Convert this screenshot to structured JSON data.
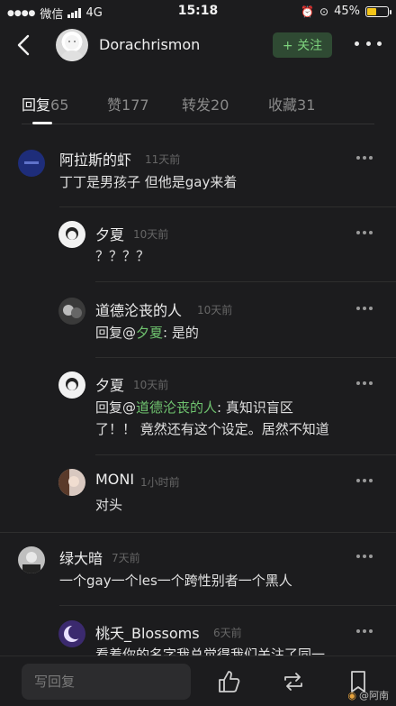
{
  "status_bar": {
    "carrier": "微信",
    "network": "4G",
    "time": "15:18",
    "battery": "45%",
    "battery_level": 0.45
  },
  "header": {
    "username": "Dorachrismon",
    "follow_label": "+ 关注"
  },
  "tabs": [
    {
      "label": "回复",
      "count": "65"
    },
    {
      "label": "赞",
      "count": "177"
    },
    {
      "label": "转发",
      "count": "20"
    },
    {
      "label": "收藏",
      "count": "31"
    }
  ],
  "comments": [
    {
      "name": "阿拉斯的虾",
      "time": "11天前",
      "text": "丁丁是男孩子 但他是gay来着"
    },
    {
      "name": "夕夏",
      "time": "10天前",
      "text": "？？？？"
    },
    {
      "name": "道德沦丧的人",
      "time": "10天前",
      "text_prefix": "回复@",
      "mention": "夕夏",
      "text_suffix": ": 是的"
    },
    {
      "name": "夕夏",
      "time": "10天前",
      "text_prefix": "回复@",
      "mention": "道德沦丧的人",
      "text_suffix": ": 真知识盲区",
      "text_line2": "了！！ 竟然还有这个设定。居然不知道"
    },
    {
      "name": "MONI",
      "time": "1小时前",
      "text": "对头"
    },
    {
      "name": "绿大暗",
      "time": "7天前",
      "text": "一个gay一个les一个跨性别者一个黑人"
    },
    {
      "name": "桃夭_Blossoms",
      "time": "6天前",
      "text": "看着你的名字我总觉得我们关注了同一"
    }
  ],
  "bottom_bar": {
    "reply_placeholder": "写回复",
    "watermark": "@阿南"
  },
  "colors": {
    "background": "#1c1c1e",
    "mention": "#6fc36f",
    "follow_bg": "#2f4a33",
    "follow_text": "#7ed37e"
  }
}
